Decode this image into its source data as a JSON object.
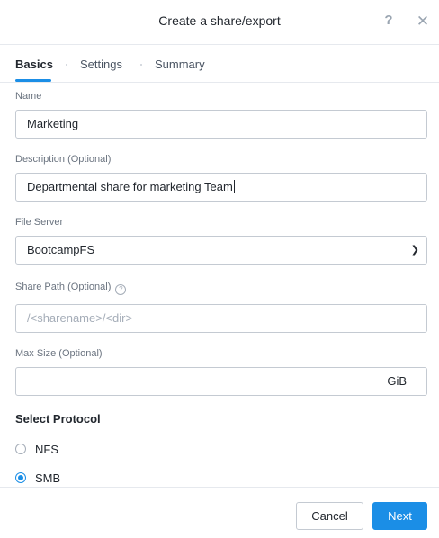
{
  "dialog": {
    "title": "Create a share/export",
    "help_label": "?",
    "close_label": "✕"
  },
  "tabs": [
    {
      "label": "Basics",
      "active": true
    },
    {
      "label": "Settings",
      "active": false
    },
    {
      "label": "Summary",
      "active": false
    }
  ],
  "form": {
    "name": {
      "label": "Name",
      "value": "Marketing"
    },
    "description": {
      "label": "Description (Optional)",
      "value": "Departmental share for marketing Team"
    },
    "file_server": {
      "label": "File Server",
      "value": "BootcampFS"
    },
    "share_path": {
      "label": "Share Path (Optional)",
      "placeholder": "/<sharename>/<dir>",
      "info_label": "?"
    },
    "max_size": {
      "label": "Max Size (Optional)",
      "value": "",
      "unit": "GiB"
    },
    "protocol": {
      "title": "Select Protocol",
      "options": [
        {
          "label": "NFS",
          "checked": false
        },
        {
          "label": "SMB",
          "checked": true
        }
      ]
    }
  },
  "footer": {
    "cancel_label": "Cancel",
    "next_label": "Next"
  },
  "colors": {
    "accent": "#1b8ee6",
    "border": "#c4cad2",
    "label": "#6b7480"
  },
  "icons": {
    "help": "help-icon",
    "close": "close-icon",
    "dropdown": "chevron-down-icon",
    "info": "info-icon"
  }
}
